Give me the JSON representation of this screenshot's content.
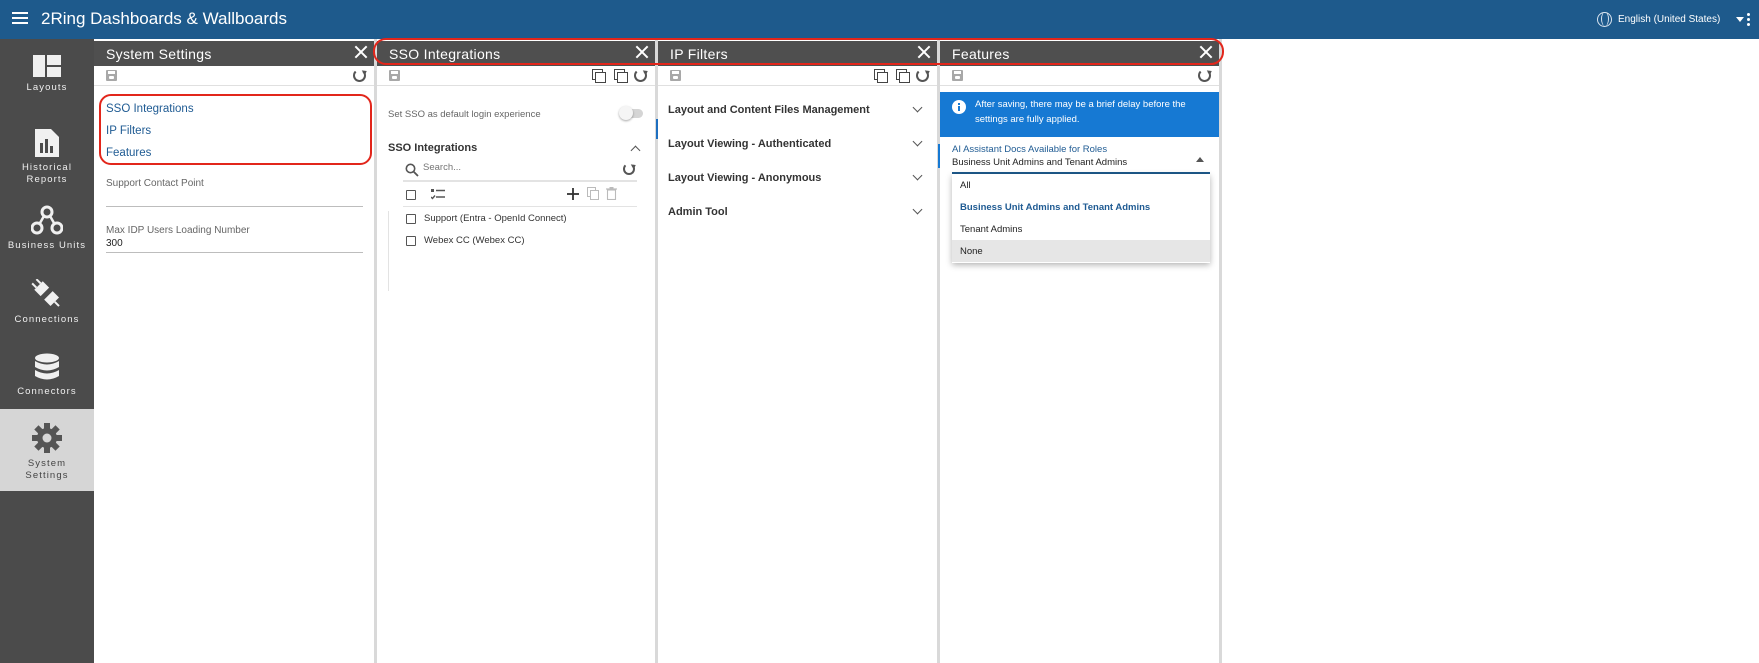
{
  "app": {
    "title": "2Ring Dashboards & Wallboards",
    "language": "English (United States)"
  },
  "nav": {
    "items": [
      {
        "label": "Layouts",
        "icon": "layouts-icon"
      },
      {
        "label": "Historical Reports",
        "icon": "historical-reports-icon"
      },
      {
        "label": "Business Units",
        "icon": "business-units-icon"
      },
      {
        "label": "Connections",
        "icon": "connections-icon"
      },
      {
        "label": "Connectors",
        "icon": "connectors-icon"
      },
      {
        "label": "System Settings",
        "icon": "system-settings-icon",
        "active": true
      }
    ],
    "labels": {
      "layouts": "Layouts",
      "historical_1": "Historical",
      "historical_2": "Reports",
      "business_units": "Business Units",
      "connections": "Connections",
      "connectors": "Connectors",
      "system_1": "System",
      "system_2": "Settings"
    }
  },
  "system_settings": {
    "title": "System Settings",
    "links": [
      "SSO Integrations",
      "IP Filters",
      "Features"
    ],
    "support_label": "Support Contact Point",
    "support_value": "",
    "max_idp_label": "Max IDP Users Loading Number",
    "max_idp_value": "300"
  },
  "sso": {
    "title": "SSO Integrations",
    "default_login_label": "Set SSO as default login experience",
    "default_login_enabled": false,
    "section_title": "SSO Integrations",
    "search_placeholder": "Search...",
    "items": [
      "Support (Entra - OpenId Connect)",
      "Webex CC (Webex CC)"
    ]
  },
  "ip_filters": {
    "title": "IP Filters",
    "sections": [
      "Layout and Content Files Management",
      "Layout Viewing - Authenticated",
      "Layout Viewing - Anonymous",
      "Admin Tool"
    ]
  },
  "features": {
    "title": "Features",
    "info_line1": "After saving, there may be a brief delay before the",
    "info_line2": "settings are fully applied.",
    "ai_label": "AI Assistant Docs Available for Roles",
    "ai_value": "Business Unit Admins and Tenant Admins",
    "options": [
      "All",
      "Business Unit Admins and Tenant Admins",
      "Tenant Admins",
      "None"
    ],
    "selected_option": "Business Unit Admins and Tenant Admins",
    "hovered_option": "None"
  },
  "colors": {
    "topbar": "#1e5a8c",
    "nav": "#4b4b4b",
    "panel_header": "#4f4f4f",
    "link": "#1f5b93",
    "info": "#1679d3",
    "highlight": "#e2261b"
  }
}
